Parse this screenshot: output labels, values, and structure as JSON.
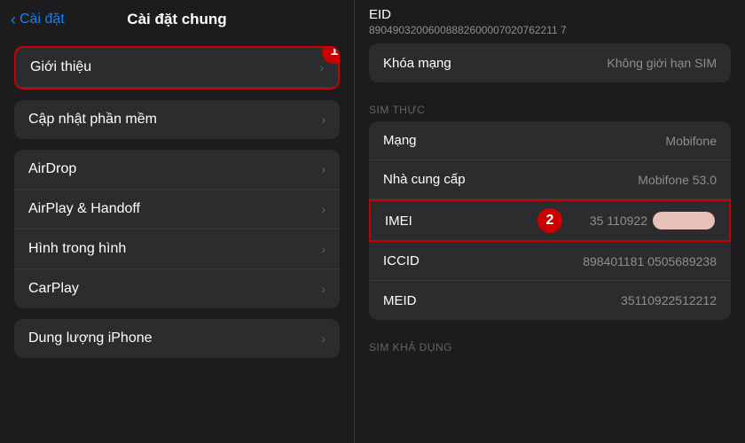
{
  "leftPanel": {
    "back_label": "Cài đặt",
    "title": "Cài đặt chung",
    "group1": {
      "items": [
        {
          "label": "Giới thiệu",
          "highlighted": true
        }
      ]
    },
    "group2": {
      "items": [
        {
          "label": "Cập nhật phần mềm"
        }
      ]
    },
    "group3": {
      "items": [
        {
          "label": "AirDrop"
        },
        {
          "label": "AirPlay & Handoff"
        },
        {
          "label": "Hình trong hình"
        },
        {
          "label": "CarPlay"
        }
      ]
    },
    "group4": {
      "items": [
        {
          "label": "Dung lượng iPhone"
        }
      ]
    },
    "step1_label": "1"
  },
  "rightPanel": {
    "eid_label": "EID",
    "eid_value": "89049032006008882600007020762211 7",
    "khoa_mang_label": "Khóa mạng",
    "khoa_mang_value": "Không giới hạn SIM",
    "sim_thuc_header": "SIM THỰC",
    "mang_label": "Mạng",
    "mang_value": "Mobifone",
    "nha_cung_cap_label": "Nhà cung cấp",
    "nha_cung_cap_value": "Mobifone 53.0",
    "imei_label": "IMEI",
    "imei_value": "35 110922",
    "iccid_label": "ICCID",
    "iccid_value": "898401181 0505689238",
    "meid_label": "MEID",
    "meid_value": "35110922512212",
    "sim_kha_dung_header": "SIM KHẢ DỤNG",
    "step2_label": "2"
  }
}
